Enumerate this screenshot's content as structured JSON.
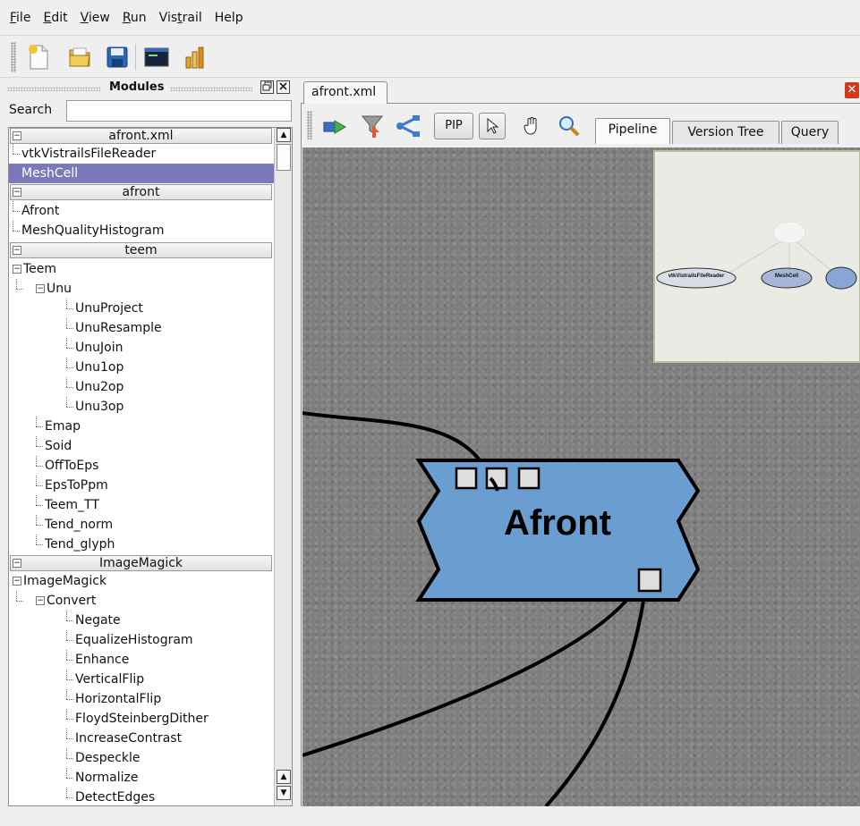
{
  "menu": [
    "File",
    "Edit",
    "View",
    "Run",
    "Vistrail",
    "Help"
  ],
  "toolbar": {
    "icons": [
      "new-file-icon",
      "open-folder-icon",
      "save-disk-icon",
      "console-icon",
      "version-bar-icon"
    ]
  },
  "dock": {
    "title": "Modules",
    "search_label": "Search",
    "search_value": ""
  },
  "tree": {
    "packages": [
      {
        "name": "afront.xml",
        "items": [
          "vtkVistrailsFileReader",
          "MeshCell"
        ],
        "selected": "MeshCell"
      },
      {
        "name": "afront",
        "items": [
          "Afront",
          "MeshQualityHistogram"
        ]
      },
      {
        "name": "teem",
        "root": "Teem",
        "group": "Unu",
        "group_items": [
          "UnuProject",
          "UnuResample",
          "UnuJoin",
          "Unu1op",
          "Unu2op",
          "Unu3op"
        ],
        "items": [
          "Emap",
          "Soid",
          "OffToEps",
          "EpsToPpm",
          "Teem_TT",
          "Tend_norm",
          "Tend_glyph"
        ]
      },
      {
        "name": "ImageMagick",
        "root": "ImageMagick",
        "group": "Convert",
        "group_items": [
          "Negate",
          "EqualizeHistogram",
          "Enhance",
          "VerticalFlip",
          "HorizontalFlip",
          "FloydSteinbergDither",
          "IncreaseContrast",
          "Despeckle",
          "Normalize",
          "DetectEdges"
        ]
      }
    ]
  },
  "document_tab": "afront.xml",
  "pipeline_tools": {
    "pip_label": "PIP",
    "tabs": [
      "Pipeline",
      "Version Tree",
      "Query"
    ],
    "active_tab": "Pipeline"
  },
  "canvas": {
    "module_name": "Afront",
    "module_color": "#6a9ed0",
    "overview_nodes": [
      "vtkVistrailsFileReader",
      "MeshCell",
      ""
    ]
  },
  "colors": {
    "selection": "#7b79b8",
    "close_tab": "#d13a1c"
  }
}
